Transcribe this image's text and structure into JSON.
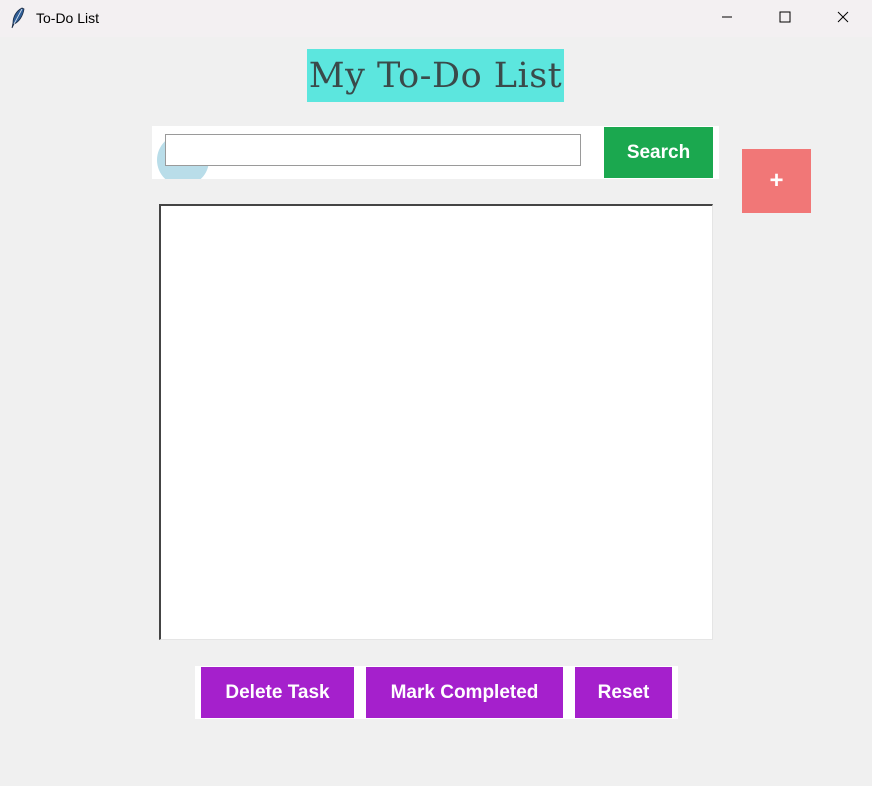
{
  "window": {
    "title": "To-Do List",
    "icon": "feather-icon",
    "controls": [
      "minimize-icon",
      "maximize-icon",
      "close-icon"
    ]
  },
  "header": {
    "title": "My To-Do List",
    "background_color": "#5ce6de"
  },
  "search": {
    "value": "",
    "placeholder": "",
    "button_label": "Search",
    "button_color": "#1ba84f"
  },
  "add_button": {
    "label": "+",
    "color": "#f17777"
  },
  "task_list": {
    "items": []
  },
  "actions": {
    "delete_label": "Delete Task",
    "complete_label": "Mark Completed",
    "reset_label": "Reset",
    "button_color": "#a520cc"
  }
}
